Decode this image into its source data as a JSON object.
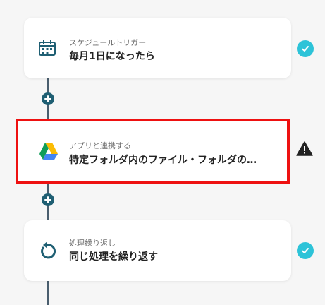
{
  "steps": [
    {
      "label": "スケジュールトリガー",
      "title": "毎月1日になったら",
      "icon": "calendar-clock-icon",
      "status": "complete"
    },
    {
      "label": "アプリと連携する",
      "title": "特定フォルダ内のファイル・フォルダの…",
      "icon": "google-drive-icon",
      "status": "warning"
    },
    {
      "label": "処理繰り返し",
      "title": "同じ処理を繰り返す",
      "icon": "loop-arrow-icon",
      "status": "complete"
    }
  ],
  "colors": {
    "accent": "#1f5f73",
    "selected_border": "#ee1111",
    "complete": "#2dc3d8",
    "warning": "#222222"
  }
}
